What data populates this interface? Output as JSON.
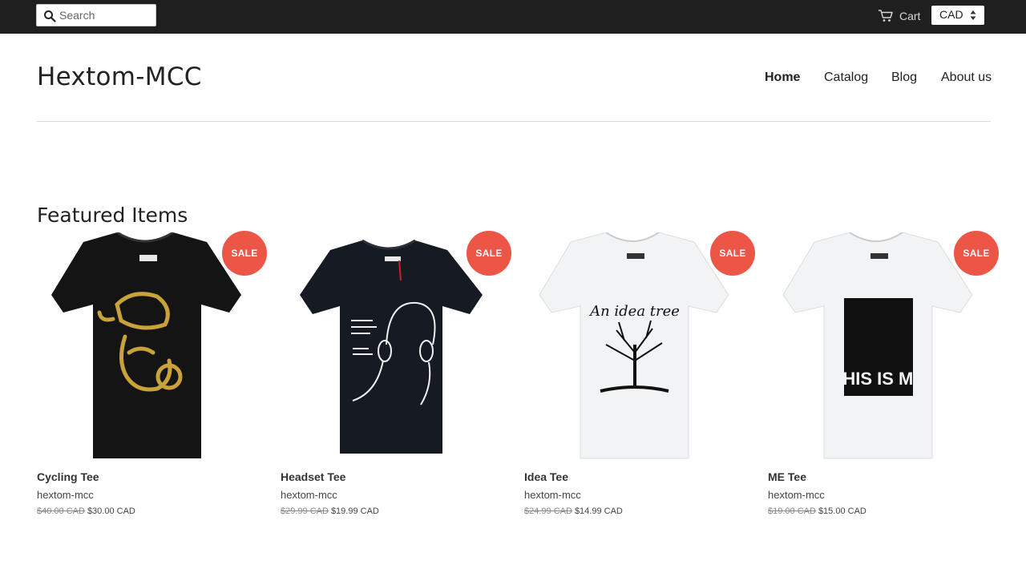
{
  "topbar": {
    "search_placeholder": "Search",
    "search_icon": "search-icon",
    "cart_label": "Cart",
    "cart_icon": "cart-icon",
    "currency": "CAD"
  },
  "header": {
    "brand": "Hextom-MCC",
    "nav": [
      {
        "label": "Home",
        "active": true
      },
      {
        "label": "Catalog",
        "active": false
      },
      {
        "label": "Blog",
        "active": false
      },
      {
        "label": "About us",
        "active": false
      }
    ]
  },
  "main": {
    "section_title": "Featured Items",
    "products": [
      {
        "name": "Cycling Tee",
        "vendor": "hextom-mcc",
        "old_price": "$40.00 CAD",
        "price": "$30.00 CAD",
        "badge": "SALE",
        "shirt_color": "#141414",
        "print_text": ""
      },
      {
        "name": "Headset Tee",
        "vendor": "hextom-mcc",
        "old_price": "$29.99 CAD",
        "price": "$19.99 CAD",
        "badge": "SALE",
        "shirt_color": "#161a22",
        "print_text": ""
      },
      {
        "name": "Idea Tee",
        "vendor": "hextom-mcc",
        "old_price": "$24.99 CAD",
        "price": "$14.99 CAD",
        "badge": "SALE",
        "shirt_color": "#f2f3f5",
        "print_text": "An idea tree"
      },
      {
        "name": "ME Tee",
        "vendor": "hextom-mcc",
        "old_price": "$19.00 CAD",
        "price": "$15.00 CAD",
        "badge": "SALE",
        "shirt_color": "#f2f3f5",
        "print_text": "THIS IS ME"
      }
    ]
  },
  "colors": {
    "topbar_bg": "#1f1f1f",
    "sale_badge": "#ec5646",
    "divider": "#d9d9d9"
  }
}
